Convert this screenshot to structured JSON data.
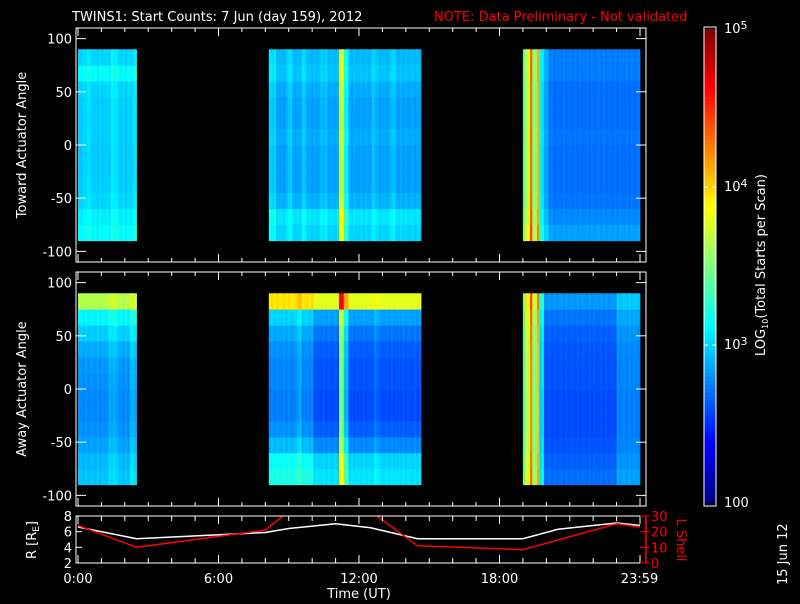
{
  "title": "TWINS1: Start Counts:  7 Jun (day 159), 2012",
  "note": "NOTE: Data Preliminary - Not validated",
  "side_date": "15 Jun 12",
  "colors": {
    "background": "#000000",
    "axes": "#ffffff",
    "note": "#ff0000",
    "r_line": "#ffffff",
    "l_line": "#ff0000"
  },
  "chart_data": {
    "type": "heatmap",
    "xlabel": "Time (UT)",
    "x_unit": "hours",
    "xlim": [
      0,
      24
    ],
    "xticks": [
      {
        "v": 0,
        "label": "0:00"
      },
      {
        "v": 6,
        "label": "6:00"
      },
      {
        "v": 12,
        "label": "12:00"
      },
      {
        "v": 18,
        "label": "18:00"
      },
      {
        "v": 23.98,
        "label": "23:59"
      }
    ],
    "colorbar": {
      "label": "LOG10(Total Starts per Scan)",
      "label_main": "LOG",
      "label_sub": "10",
      "label_rest": "(Total Starts per Scan)",
      "log_range": [
        2,
        5
      ],
      "ticks": [
        {
          "v": 5,
          "label": "10",
          "exp": "5"
        },
        {
          "v": 4,
          "label": "10",
          "exp": "4"
        },
        {
          "v": 3,
          "label": "10",
          "exp": "3"
        },
        {
          "v": 2,
          "label": "100",
          "exp": ""
        }
      ],
      "colormap": "jet"
    },
    "panels": [
      {
        "ylabel": "Toward Actuator Angle",
        "ylim": [
          -110,
          110
        ],
        "yticks": [
          100,
          50,
          0,
          -50,
          -100
        ],
        "angle_bins": [
          -90,
          -75,
          -60,
          -45,
          -30,
          -15,
          0,
          15,
          30,
          45,
          60,
          75,
          90
        ],
        "blocks": [
          {
            "t0": 0,
            "t1": 2.5,
            "profile": [
              3.12,
              3.08,
              3.0,
              2.98,
              2.97,
              2.97,
              2.98,
              2.98,
              2.98,
              3.0,
              3.12,
              3.0
            ],
            "stripes": [
              {
                "t0": 0.3,
                "t1": 0.6,
                "d": 0.05
              },
              {
                "t0": 1.4,
                "t1": 1.7,
                "d": 0.08
              },
              {
                "t0": 2.3,
                "t1": 2.5,
                "d": 0.05
              }
            ]
          },
          {
            "t0": 8.15,
            "t1": 14.6,
            "profile": [
              3.0,
              3.05,
              2.9,
              2.85,
              2.85,
              2.85,
              2.88,
              2.85,
              2.85,
              2.88,
              2.95,
              2.92
            ],
            "stripes": [
              {
                "t0": 8.15,
                "t1": 8.5,
                "d": 0.12
              },
              {
                "t0": 8.9,
                "t1": 9.1,
                "d": 0.12
              },
              {
                "t0": 9.5,
                "t1": 9.7,
                "d": 0.1
              },
              {
                "t0": 10.3,
                "t1": 10.6,
                "d": 0.06
              },
              {
                "t0": 11.1,
                "t1": 11.32,
                "d": 0.85
              },
              {
                "t0": 11.32,
                "t1": 11.5,
                "d": 0.25
              },
              {
                "t0": 12.5,
                "t1": 12.7,
                "d": 0.08
              },
              {
                "t0": 13.3,
                "t1": 13.5,
                "d": 0.1
              }
            ]
          },
          {
            "t0": 19.0,
            "t1": 24,
            "profile": [
              2.85,
              2.78,
              2.72,
              2.7,
              2.7,
              2.7,
              2.72,
              2.7,
              2.7,
              2.7,
              2.74,
              2.74
            ],
            "stripes": [
              {
                "t0": 19.0,
                "t1": 19.15,
                "d": 0.6
              },
              {
                "t0": 19.15,
                "t1": 19.3,
                "d": 1.0
              },
              {
                "t0": 19.3,
                "t1": 19.45,
                "d": 1.6
              },
              {
                "t0": 19.45,
                "t1": 19.6,
                "d": 0.8
              },
              {
                "t0": 19.6,
                "t1": 19.75,
                "d": 1.4
              },
              {
                "t0": 19.75,
                "t1": 19.9,
                "d": 0.35
              },
              {
                "t0": 19.9,
                "t1": 20.1,
                "d": 0.15
              }
            ]
          }
        ]
      },
      {
        "ylabel": "Away Actuator Angle",
        "ylim": [
          -110,
          110
        ],
        "yticks": [
          100,
          50,
          0,
          -50,
          -100
        ],
        "angle_bins": [
          -90,
          -75,
          -60,
          -45,
          -30,
          -15,
          0,
          15,
          30,
          45,
          60,
          75,
          90
        ],
        "blocks": [
          {
            "t0": 0,
            "t1": 2.5,
            "profile": [
              2.95,
              2.92,
              2.85,
              2.8,
              2.78,
              2.78,
              2.8,
              2.82,
              2.88,
              2.98,
              3.1,
              3.65
            ],
            "stripes": [
              {
                "t0": 1.3,
                "t1": 1.7,
                "d": 0.08
              },
              {
                "t0": 2.2,
                "t1": 2.5,
                "d": 0.1
              }
            ]
          },
          {
            "t0": 8.15,
            "t1": 14.6,
            "profile": [
              3.05,
              3.0,
              2.78,
              2.65,
              2.6,
              2.6,
              2.62,
              2.62,
              2.65,
              2.72,
              2.85,
              3.8
            ],
            "stripes": [
              {
                "t0": 8.15,
                "t1": 10.0,
                "d": 0.15
              },
              {
                "t0": 11.1,
                "t1": 11.32,
                "d": 0.85
              },
              {
                "t0": 11.32,
                "t1": 11.5,
                "d": 0.3
              },
              {
                "t0": 9.3,
                "t1": 9.5,
                "d": 0.1
              },
              {
                "t0": 12.6,
                "t1": 12.8,
                "d": 0.08
              }
            ]
          },
          {
            "t0": 19.0,
            "t1": 24,
            "profile": [
              2.7,
              2.66,
              2.62,
              2.6,
              2.6,
              2.6,
              2.62,
              2.62,
              2.63,
              2.66,
              2.72,
              2.82
            ],
            "stripes": [
              {
                "t0": 19.0,
                "t1": 19.15,
                "d": 0.7
              },
              {
                "t0": 19.15,
                "t1": 19.3,
                "d": 1.1
              },
              {
                "t0": 19.3,
                "t1": 19.45,
                "d": 1.6
              },
              {
                "t0": 19.45,
                "t1": 19.6,
                "d": 0.9
              },
              {
                "t0": 19.6,
                "t1": 19.75,
                "d": 1.4
              },
              {
                "t0": 19.75,
                "t1": 19.9,
                "d": 0.4
              },
              {
                "t0": 23.0,
                "t1": 24,
                "d": 0.15
              }
            ]
          }
        ]
      }
    ],
    "orbit": {
      "left_label": "R [R",
      "left_sub": "E",
      "left_close": "]",
      "right_label": "L Shell",
      "left_ylim": [
        2,
        8
      ],
      "left_ticks": [
        8,
        6,
        4,
        2
      ],
      "right_ylim": [
        0,
        30
      ],
      "right_ticks": [
        30,
        20,
        10,
        0
      ],
      "series": [
        {
          "name": "R",
          "x": [
            0,
            2.5,
            8,
            9,
            11,
            12.5,
            14.5,
            19,
            20.5,
            23,
            24
          ],
          "y": [
            6.6,
            5.1,
            5.9,
            6.4,
            7.0,
            6.5,
            5.1,
            5.1,
            6.3,
            7.1,
            6.8
          ]
        },
        {
          "name": "L Shell",
          "x": [
            0,
            2.5,
            8,
            9,
            12.5,
            14.5,
            19,
            23,
            24
          ],
          "y": [
            24,
            10,
            21,
            33,
            33,
            11,
            8.5,
            25,
            23
          ]
        }
      ]
    }
  }
}
